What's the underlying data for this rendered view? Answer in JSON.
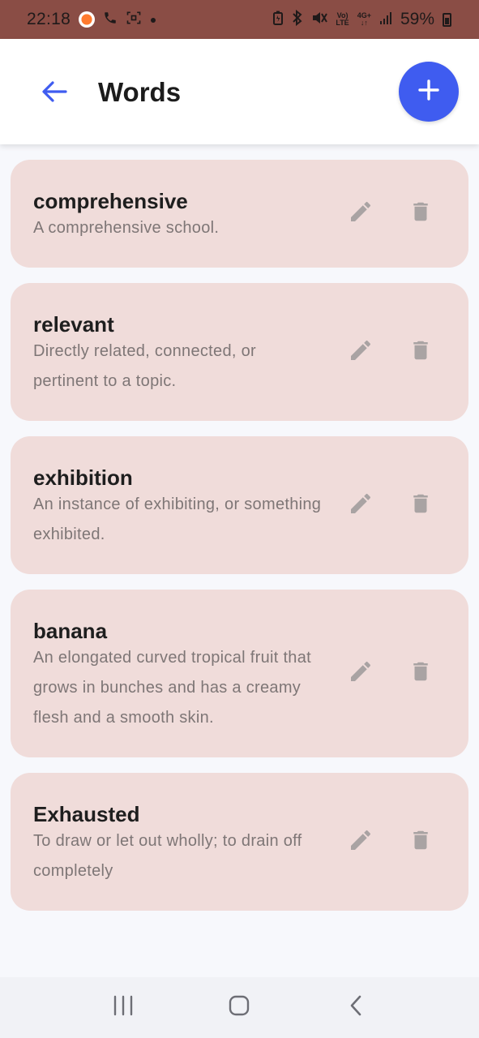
{
  "status_bar": {
    "time": "22:18",
    "battery_pct": "59%",
    "network_top": "Vo)",
    "network_bottom": "LTE",
    "signal_top": "4G+",
    "signal_bottom": "↓↑"
  },
  "app_bar": {
    "title": "Words",
    "accent_color": "#3f5cf0"
  },
  "words": [
    {
      "word": "comprehensive",
      "definition": "A comprehensive school."
    },
    {
      "word": "relevant",
      "definition": "Directly related, connected, or pertinent to a topic."
    },
    {
      "word": "exhibition",
      "definition": "An instance of exhibiting, or something exhibited."
    },
    {
      "word": "banana",
      "definition": "An elongated curved tropical fruit that grows in bunches and has a creamy flesh and a smooth skin."
    },
    {
      "word": "Exhausted",
      "definition": "To draw or let out wholly; to drain off completely"
    }
  ],
  "icons": {
    "back": "arrow-left-icon",
    "add": "plus-icon",
    "edit": "pencil-icon",
    "delete": "trash-icon"
  },
  "colors": {
    "card_bg": "#f0dcda",
    "status_bar_bg": "#8a4d45",
    "icon_muted": "#a9a3a3"
  }
}
